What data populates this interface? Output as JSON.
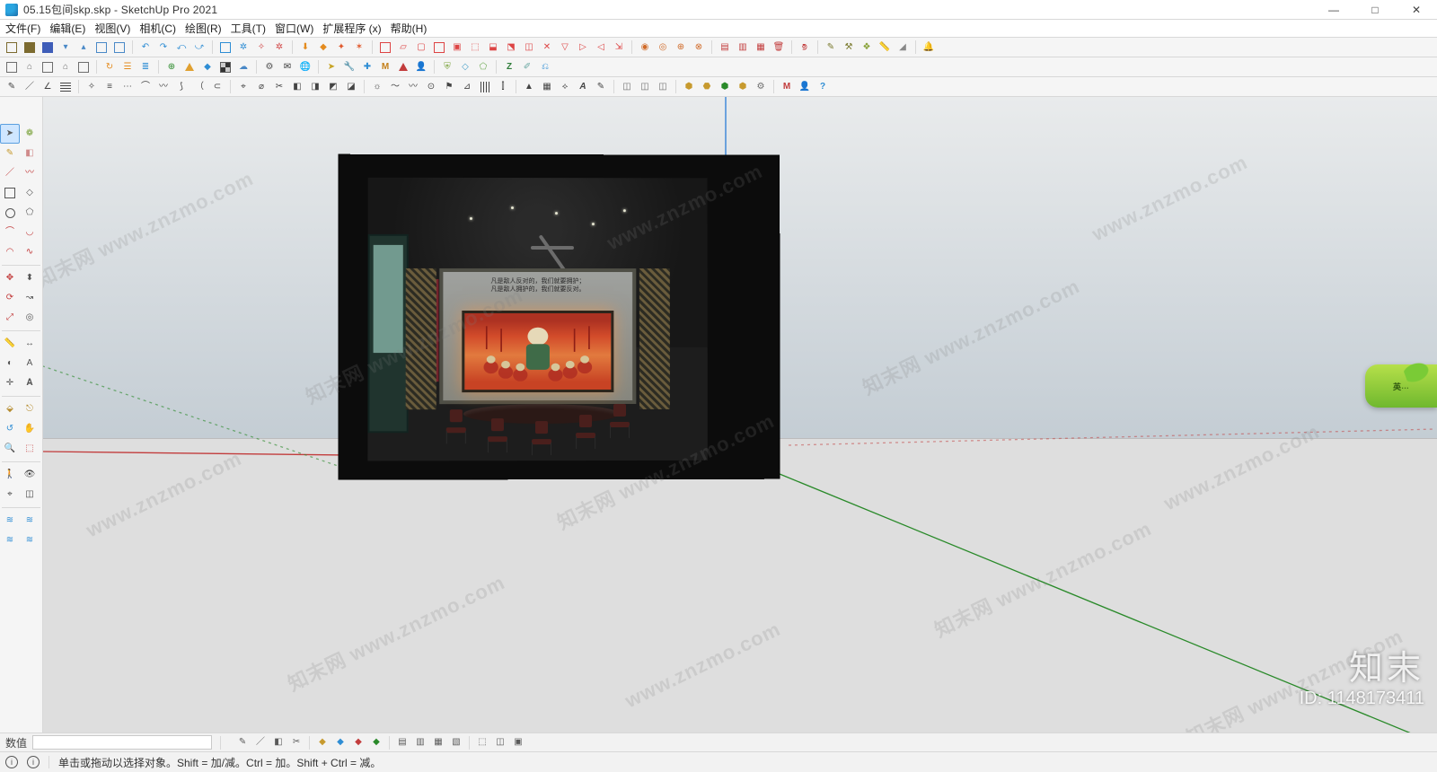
{
  "title": {
    "filename": "05.15包间skp.skp",
    "app": "SketchUp Pro 2021"
  },
  "window_buttons": {
    "minimize": "—",
    "maximize": "□",
    "close": "✕"
  },
  "menu": {
    "file": "文件(F)",
    "edit": "编辑(E)",
    "view": "视图(V)",
    "camera": "相机(C)",
    "draw": "绘图(R)",
    "tools": "工具(T)",
    "window": "窗口(W)",
    "extensions": "扩展程序 (x)",
    "help": "帮助(H)"
  },
  "side_tools": {
    "select": "arrow",
    "selectionSpray": "spray",
    "pencil": "pencil",
    "eraser": "eraser",
    "line": "line",
    "freehand": "freehand",
    "rect": "rect",
    "rotrect": "rotrect",
    "circle": "circle",
    "polygon": "polygon",
    "arc": "arc",
    "pie": "pie",
    "arc2": "arc2",
    "bezier": "bezier",
    "move": "move",
    "pushpull": "pushpull",
    "rotate": "rotate",
    "followme": "followme",
    "scale": "scale",
    "offset": "offset",
    "tape": "tape",
    "dimension": "dimension",
    "protractor": "protractor",
    "text": "text",
    "axes": "axes",
    "3dtext": "3dtext",
    "section": "section",
    "walk": "walk",
    "orbit": "orbit",
    "pan": "pan",
    "zoom": "zoom",
    "zoomwin": "zoomwin",
    "zoomext": "zoomext",
    "prevview": "prevview",
    "position": "position",
    "look": "look",
    "sandbox1": "sandbox1",
    "sandbox2": "sandbox2"
  },
  "statusbar": {
    "hint": "单击或拖动以选择对象。Shift = 加/减。Ctrl = 加。Shift + Ctrl = 减。",
    "value_label": "数值"
  },
  "scene_text": {
    "slogan_line1": "凡是敌人反对的，我们就要拥护；",
    "slogan_line2": "凡是敌人拥护的，我们就要反对。"
  },
  "watermark": {
    "text": "知末网 www.znzmo.com",
    "plain": "www.znzmo.com",
    "id_label": "ID: 1148173411",
    "brand": "知末",
    "leaf": "英"
  },
  "colors": {
    "axis_x": "#c23c3c",
    "axis_y": "#2a8a2a",
    "axis_z": "#2a7cd6"
  }
}
